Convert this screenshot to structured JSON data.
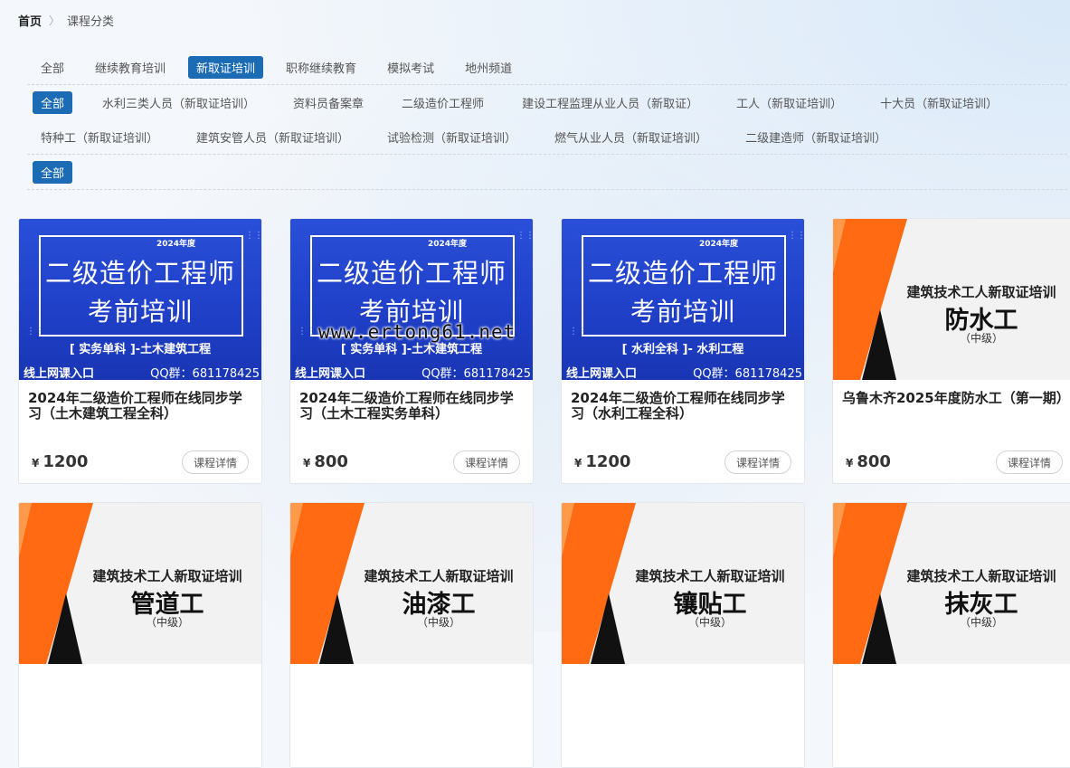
{
  "breadcrumb": {
    "home": "首页",
    "sep": ">",
    "current": "课程分类"
  },
  "filters": {
    "row1": [
      "全部",
      "继续教育培训",
      "新取证培训",
      "职称继续教育",
      "模拟考试",
      "地州频道"
    ],
    "row1_active": 2,
    "row2": [
      "全部",
      "水利三类人员（新取证培训）",
      "资料员备案章",
      "二级造价工程师",
      "建设工程监理从业人员（新取证）",
      "工人（新取证培训）",
      "十大员（新取证培训）"
    ],
    "row3": [
      "特种工（新取证培训）",
      "建筑安管人员（新取证培训）",
      "试验检测（新取证培训）",
      "燃气从业人员（新取证培训）",
      "二级建造师（新取证培训）"
    ],
    "row4": [
      "全部"
    ]
  },
  "cards": [
    {
      "type": "blue",
      "year": "2024年度",
      "t1": "二级造价工程师",
      "t2": "考前培训",
      "sub": "[ 实务单科 ]-土木建筑工程",
      "entry": "线上网课入口",
      "qq": "QQ群：681178425",
      "title": "2024年二级造价工程师在线同步学习（土木建筑工程全科）",
      "price": "1200",
      "detail": "课程详情"
    },
    {
      "type": "blue",
      "year": "2024年度",
      "t1": "二级造价工程师",
      "t2": "考前培训",
      "sub": "[ 实务单科 ]-土木建筑工程",
      "entry": "线上网课入口",
      "qq": "QQ群：681178425",
      "title": "2024年二级造价工程师在线同步学习（土木工程实务单科）",
      "price": "800",
      "detail": "课程详情"
    },
    {
      "type": "blue",
      "year": "2024年度",
      "t1": "二级造价工程师",
      "t2": "考前培训",
      "sub": "[ 水利全科 ]- 水利工程",
      "entry": "线上网课入口",
      "qq": "QQ群：681178425",
      "title": "2024年二级造价工程师在线同步学习（水利工程全科）",
      "price": "1200",
      "detail": "课程详情"
    },
    {
      "type": "orange",
      "head": "建筑技术工人新取证培训",
      "big": "防水工",
      "lvl": "（中级）",
      "title": "乌鲁木齐2025年度防水工（第一期）",
      "price": "800",
      "detail": "课程详情"
    },
    {
      "type": "orange",
      "head": "建筑技术工人新取证培训",
      "big": "管道工",
      "lvl": "（中级）"
    },
    {
      "type": "orange",
      "head": "建筑技术工人新取证培训",
      "big": "油漆工",
      "lvl": "（中级）"
    },
    {
      "type": "orange",
      "head": "建筑技术工人新取证培训",
      "big": "镶贴工",
      "lvl": "（中级）"
    },
    {
      "type": "orange",
      "head": "建筑技术工人新取证培训",
      "big": "抹灰工",
      "lvl": "（中级）"
    }
  ],
  "currency": "¥",
  "watermark": "www.ertong61.net",
  "colors": {
    "accent": "#1c6bb5",
    "banner_blue": "#2a4fd8",
    "banner_orange": "#ff6a13"
  }
}
